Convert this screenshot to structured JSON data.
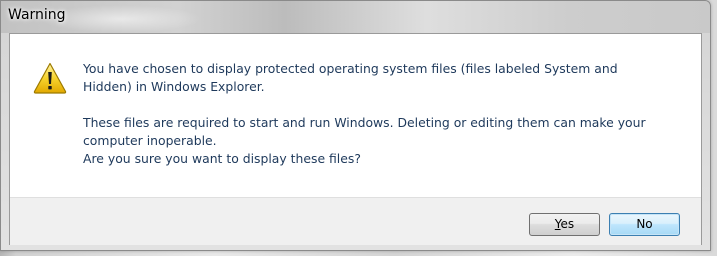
{
  "window": {
    "title": "Warning"
  },
  "dialog": {
    "icon": "warning-triangle-icon",
    "message": [
      "You have chosen to display protected operating system files (files labeled System and",
      "Hidden) in Windows Explorer.",
      "These files are required to start and run Windows. Deleting or editing them can make your",
      "computer inoperable.",
      "Are you sure you want to display these files?"
    ]
  },
  "buttons": {
    "yes": {
      "mnemonic": "Y",
      "rest": "es"
    },
    "no": {
      "label": "No"
    }
  },
  "colors": {
    "message_text": "#1e395b",
    "default_button_border": "#3c7fb1",
    "warning_yellow": "#f5c518"
  }
}
